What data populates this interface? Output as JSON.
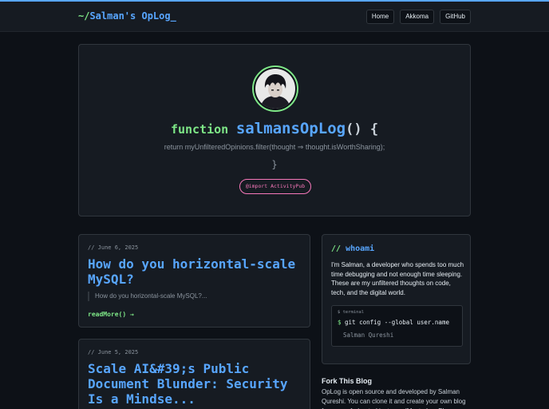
{
  "header": {
    "logo_prefix": "~/",
    "logo_text": "Salman's OpLog_",
    "nav": [
      {
        "label": "Home"
      },
      {
        "label": "Akkoma"
      },
      {
        "label": "GitHub"
      }
    ]
  },
  "hero": {
    "keyword": "function",
    "name": "salmansOpLog",
    "paren": "() {",
    "return_line": "return myUnfilteredOpinions.filter(thought ⇒ thought.isWorthSharing);",
    "closing_brace": "}",
    "import_button": "@import ActivityPub"
  },
  "posts": [
    {
      "date": "// June 6, 2025",
      "title": "How do you horizontal-scale MySQL?",
      "excerpt": "How do you horizontal-scale MySQL?...",
      "read_more": "readMore() →"
    },
    {
      "date": "// June 5, 2025",
      "title": "Scale AI&#39;s Public Document Blunder: Security Is a Mindse..."
    }
  ],
  "whoami": {
    "slashes": "//",
    "title": "whoami",
    "bio": "I'm Salman, a developer who spends too much time debugging and not enough time sleeping. These are my unfiltered thoughts on code, tech, and the digital world.",
    "terminal": {
      "label": "$ terminal",
      "prompt": "$",
      "command": "git config --global user.name",
      "output": "Salman Qureshi"
    }
  },
  "fork": {
    "title": "Fork This Blog",
    "text": "OpLog is open source and developed by Salman Qureshi. You can clone it and create your own blog from your federated instance (Mastodon, Pleroma, or"
  },
  "colors": {
    "background": "#0d1117",
    "surface": "#161b22",
    "accent_blue": "#58a6ff",
    "accent_green": "#7ee787",
    "accent_pink": "#f778ba"
  }
}
